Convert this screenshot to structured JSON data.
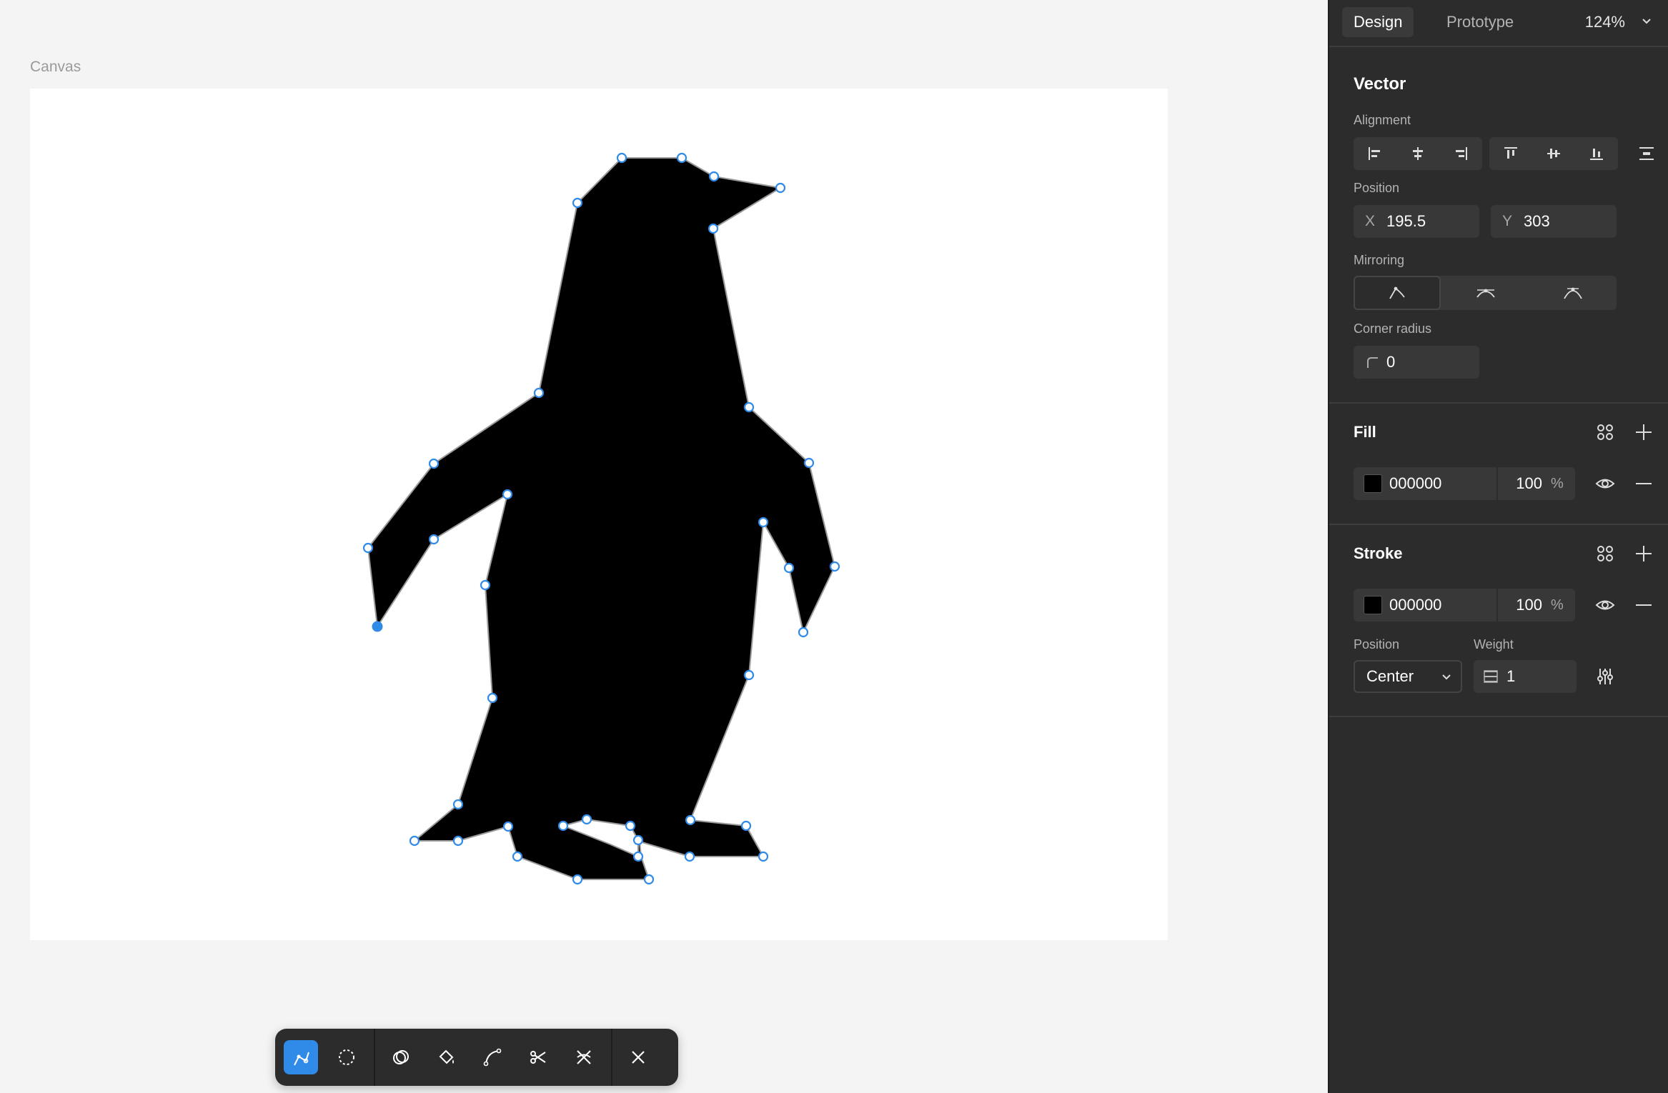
{
  "canvas": {
    "label": "Canvas"
  },
  "header": {
    "tabs": [
      "Design",
      "Prototype"
    ],
    "active_tab": "Design",
    "zoom": "124%"
  },
  "layer": {
    "type_title": "Vector"
  },
  "alignment": {
    "label": "Alignment",
    "buttons": [
      "align-left",
      "align-horizontal-center",
      "align-right",
      "align-top",
      "align-vertical-center",
      "align-bottom",
      "distribute"
    ]
  },
  "position": {
    "label": "Position",
    "x_prefix": "X",
    "x_value": "195.5",
    "y_prefix": "Y",
    "y_value": "303"
  },
  "mirroring": {
    "label": "Mirroring",
    "options": [
      "no-mirroring",
      "mirror-angle",
      "mirror-angle-and-length"
    ],
    "selected": "no-mirroring"
  },
  "corner_radius": {
    "label": "Corner radius",
    "value": "0"
  },
  "fill": {
    "title": "Fill",
    "hex": "000000",
    "opacity": "100",
    "unit": "%",
    "swatch_color": "#000000"
  },
  "stroke": {
    "title": "Stroke",
    "hex": "000000",
    "opacity": "100",
    "unit": "%",
    "swatch_color": "#000000",
    "position_label": "Position",
    "position_value": "Center",
    "weight_label": "Weight",
    "weight_value": "1"
  },
  "toolbar": {
    "tools": [
      "bend-tool",
      "lasso-tool",
      "shape-builder-tool",
      "paint-bucket-tool",
      "pen-tool",
      "cut-tool",
      "vector-network-tool",
      "close-edit-mode"
    ],
    "active": "bend-tool"
  },
  "annotation": {
    "color": "#ff00aa"
  },
  "colors": {
    "selection": "#2f8ae8",
    "panel_bg": "#2c2c2c"
  }
}
